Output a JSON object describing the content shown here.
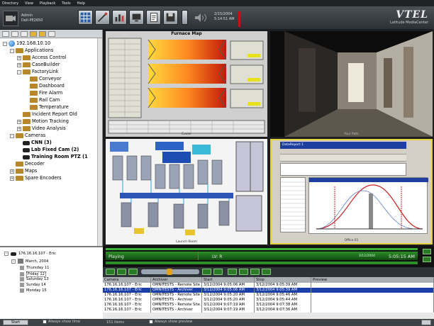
{
  "menu": [
    "Directory",
    "View",
    "Playback",
    "Tools",
    "Help"
  ],
  "user": {
    "name": "Admin",
    "server": "Dell-PE2650"
  },
  "datetime": {
    "date": "2/15/2004",
    "time": "5:14:51 AM"
  },
  "brand": {
    "name": "VTEL",
    "product": "Latitude MediaCenter"
  },
  "tree": [
    {
      "label": "192.168.10.10",
      "level": 0,
      "icon": "globe",
      "exp": "-"
    },
    {
      "label": "Applications",
      "level": 1,
      "icon": "folder",
      "exp": "-"
    },
    {
      "label": "Access Control",
      "level": 2,
      "icon": "folder",
      "exp": "+"
    },
    {
      "label": "CaseBuilder",
      "level": 2,
      "icon": "folder",
      "exp": "+"
    },
    {
      "label": "FactoryLink",
      "level": 2,
      "icon": "folder",
      "exp": "-"
    },
    {
      "label": "Conveyor",
      "level": 3,
      "icon": "folder",
      "exp": ""
    },
    {
      "label": "Dashboard",
      "level": 3,
      "icon": "folder",
      "exp": ""
    },
    {
      "label": "Fire Alarm",
      "level": 3,
      "icon": "folder",
      "exp": ""
    },
    {
      "label": "Rail Cam",
      "level": 3,
      "icon": "folder",
      "exp": ""
    },
    {
      "label": "Temperature",
      "level": 3,
      "icon": "folder",
      "exp": ""
    },
    {
      "label": "Incident Report Old",
      "level": 2,
      "icon": "folder",
      "exp": ""
    },
    {
      "label": "Motion Tracking",
      "level": 2,
      "icon": "folder",
      "exp": "+"
    },
    {
      "label": "Video Analysis",
      "level": 2,
      "icon": "folder",
      "exp": "+"
    },
    {
      "label": "Cameras",
      "level": 1,
      "icon": "folder",
      "exp": "-"
    },
    {
      "label": "CNN (3)",
      "level": 2,
      "icon": "cam",
      "exp": "",
      "bold": true
    },
    {
      "label": "Lab Fixed Cam (2)",
      "level": 2,
      "icon": "cam",
      "exp": "",
      "bold": true
    },
    {
      "label": "Training Room PTZ (1",
      "level": 2,
      "icon": "cam",
      "exp": "",
      "bold": true
    },
    {
      "label": "Decoder",
      "level": 1,
      "icon": "folder",
      "exp": ""
    },
    {
      "label": "Maps",
      "level": 1,
      "icon": "folder",
      "exp": "+"
    },
    {
      "label": "Spare Encoders",
      "level": 1,
      "icon": "folder",
      "exp": "+"
    }
  ],
  "dates": {
    "root": "176.16.16.107 - Eric",
    "month": "March, 2004",
    "days": [
      "Thursday 11",
      "Friday 12",
      "Saturday 13",
      "Sunday 14",
      "Monday 15"
    ],
    "selected_index": 1
  },
  "tiles": {
    "furnace": {
      "title": "Furnace Map",
      "caption": "Cooler"
    },
    "hallway": {
      "caption": "Your Path"
    },
    "schematic": {
      "caption": "Launch Room"
    },
    "app": {
      "caption": "Office 01",
      "title": "DataReport 1"
    }
  },
  "timeline": {
    "status": "Playing",
    "time": "5:05:15 AM",
    "date": "3/12/2004",
    "marker": "LV: R"
  },
  "table": {
    "columns": [
      "Camera",
      "Archiver",
      "Start",
      "Stop",
      "Preview"
    ],
    "rows": [
      [
        "176.16.16.107 - Eric",
        "OMNITESTS - Remote Site Ar",
        "3/12/2004 9:05:06 AM",
        "3/12/2004 9:05:39 AM",
        ""
      ],
      [
        "176.16.16.107 - Eric",
        "OMNITESTS - Archiver",
        "3/12/2004 9:05:06 AM",
        "3/12/2004 9:05:39 AM",
        ""
      ],
      [
        "176.16.16.107 - Eric",
        "OMNITESTS - Remote Site Ar",
        "3/12/2004 9:05:20 AM",
        "3/12/2004 9:05:46 AM",
        ""
      ],
      [
        "176.16.16.107 - Eric",
        "OMNITESTS - Archiver",
        "3/12/2004 9:05:20 AM",
        "3/12/2004 9:05:44 AM",
        ""
      ],
      [
        "176.16.16.107 - Eric",
        "OMNITESTS - Remote Site Ar",
        "3/12/2004 9:07:19 AM",
        "3/12/2004 9:07:38 AM",
        ""
      ],
      [
        "176.16.16.107 - Eric",
        "OMNITESTS - Archiver",
        "3/12/2004 9:07:19 AM",
        "3/12/2004 9:07:36 AM",
        ""
      ]
    ],
    "selected_index": 1
  },
  "footer": {
    "start_label": "Start",
    "always_show_time": "Always show time",
    "items_label": "151 items",
    "always_show_preview": "Always show preview"
  },
  "colors": {
    "accent": "#1b3fa8",
    "play_green": "#2a7a28",
    "selection_border": "#e4d33c"
  }
}
